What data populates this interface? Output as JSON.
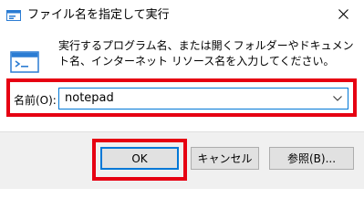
{
  "window": {
    "title": "ファイル名を指定して実行",
    "close_glyph": "✕"
  },
  "dialog": {
    "description": "実行するプログラム名、または開くフォルダーやドキュメント名、インターネット リソース名を入力してください。",
    "name_label": "名前(O):",
    "name_value": "notepad",
    "dropdown_glyph": "⌄"
  },
  "buttons": {
    "ok": "OK",
    "cancel": "キャンセル",
    "browse": "参照(B)..."
  },
  "colors": {
    "highlight": "#e60012",
    "focus": "#0078d7"
  }
}
